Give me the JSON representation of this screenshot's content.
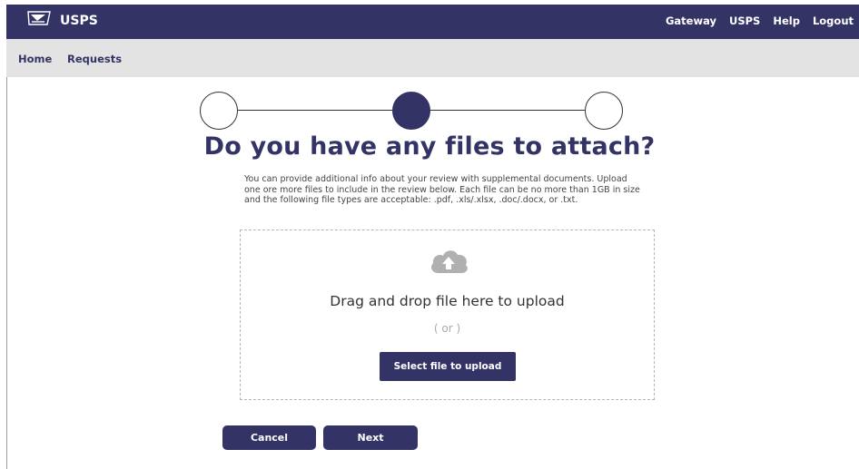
{
  "header": {
    "brand": "USPS",
    "logo_icon": "usps-eagle-logo-icon",
    "nav": [
      "Gateway",
      "USPS",
      "Help",
      "Logout"
    ]
  },
  "subnav": {
    "items": [
      "Home",
      "Requests"
    ]
  },
  "stepper": {
    "total_steps": 3,
    "current_step": 2
  },
  "main": {
    "title": "Do you have any files to attach?",
    "description": "You can provide additional info about your review with supplemental documents. Upload one ore more files to include in the review below. Each file can be no more than 1GB in size and the following file types are acceptable: .pdf, .xls/.xlsx, .doc/.docx, or .txt.",
    "dropzone": {
      "icon": "cloud-upload-icon",
      "prompt": "Drag and drop file here to upload",
      "or": "( or )",
      "button": "Select file to upload"
    },
    "actions": {
      "cancel": "Cancel",
      "next": "Next"
    }
  },
  "colors": {
    "brand_navy": "#333366",
    "subnav_gray": "#e3e3e3",
    "dropzone_border": "#b5b5b5"
  }
}
